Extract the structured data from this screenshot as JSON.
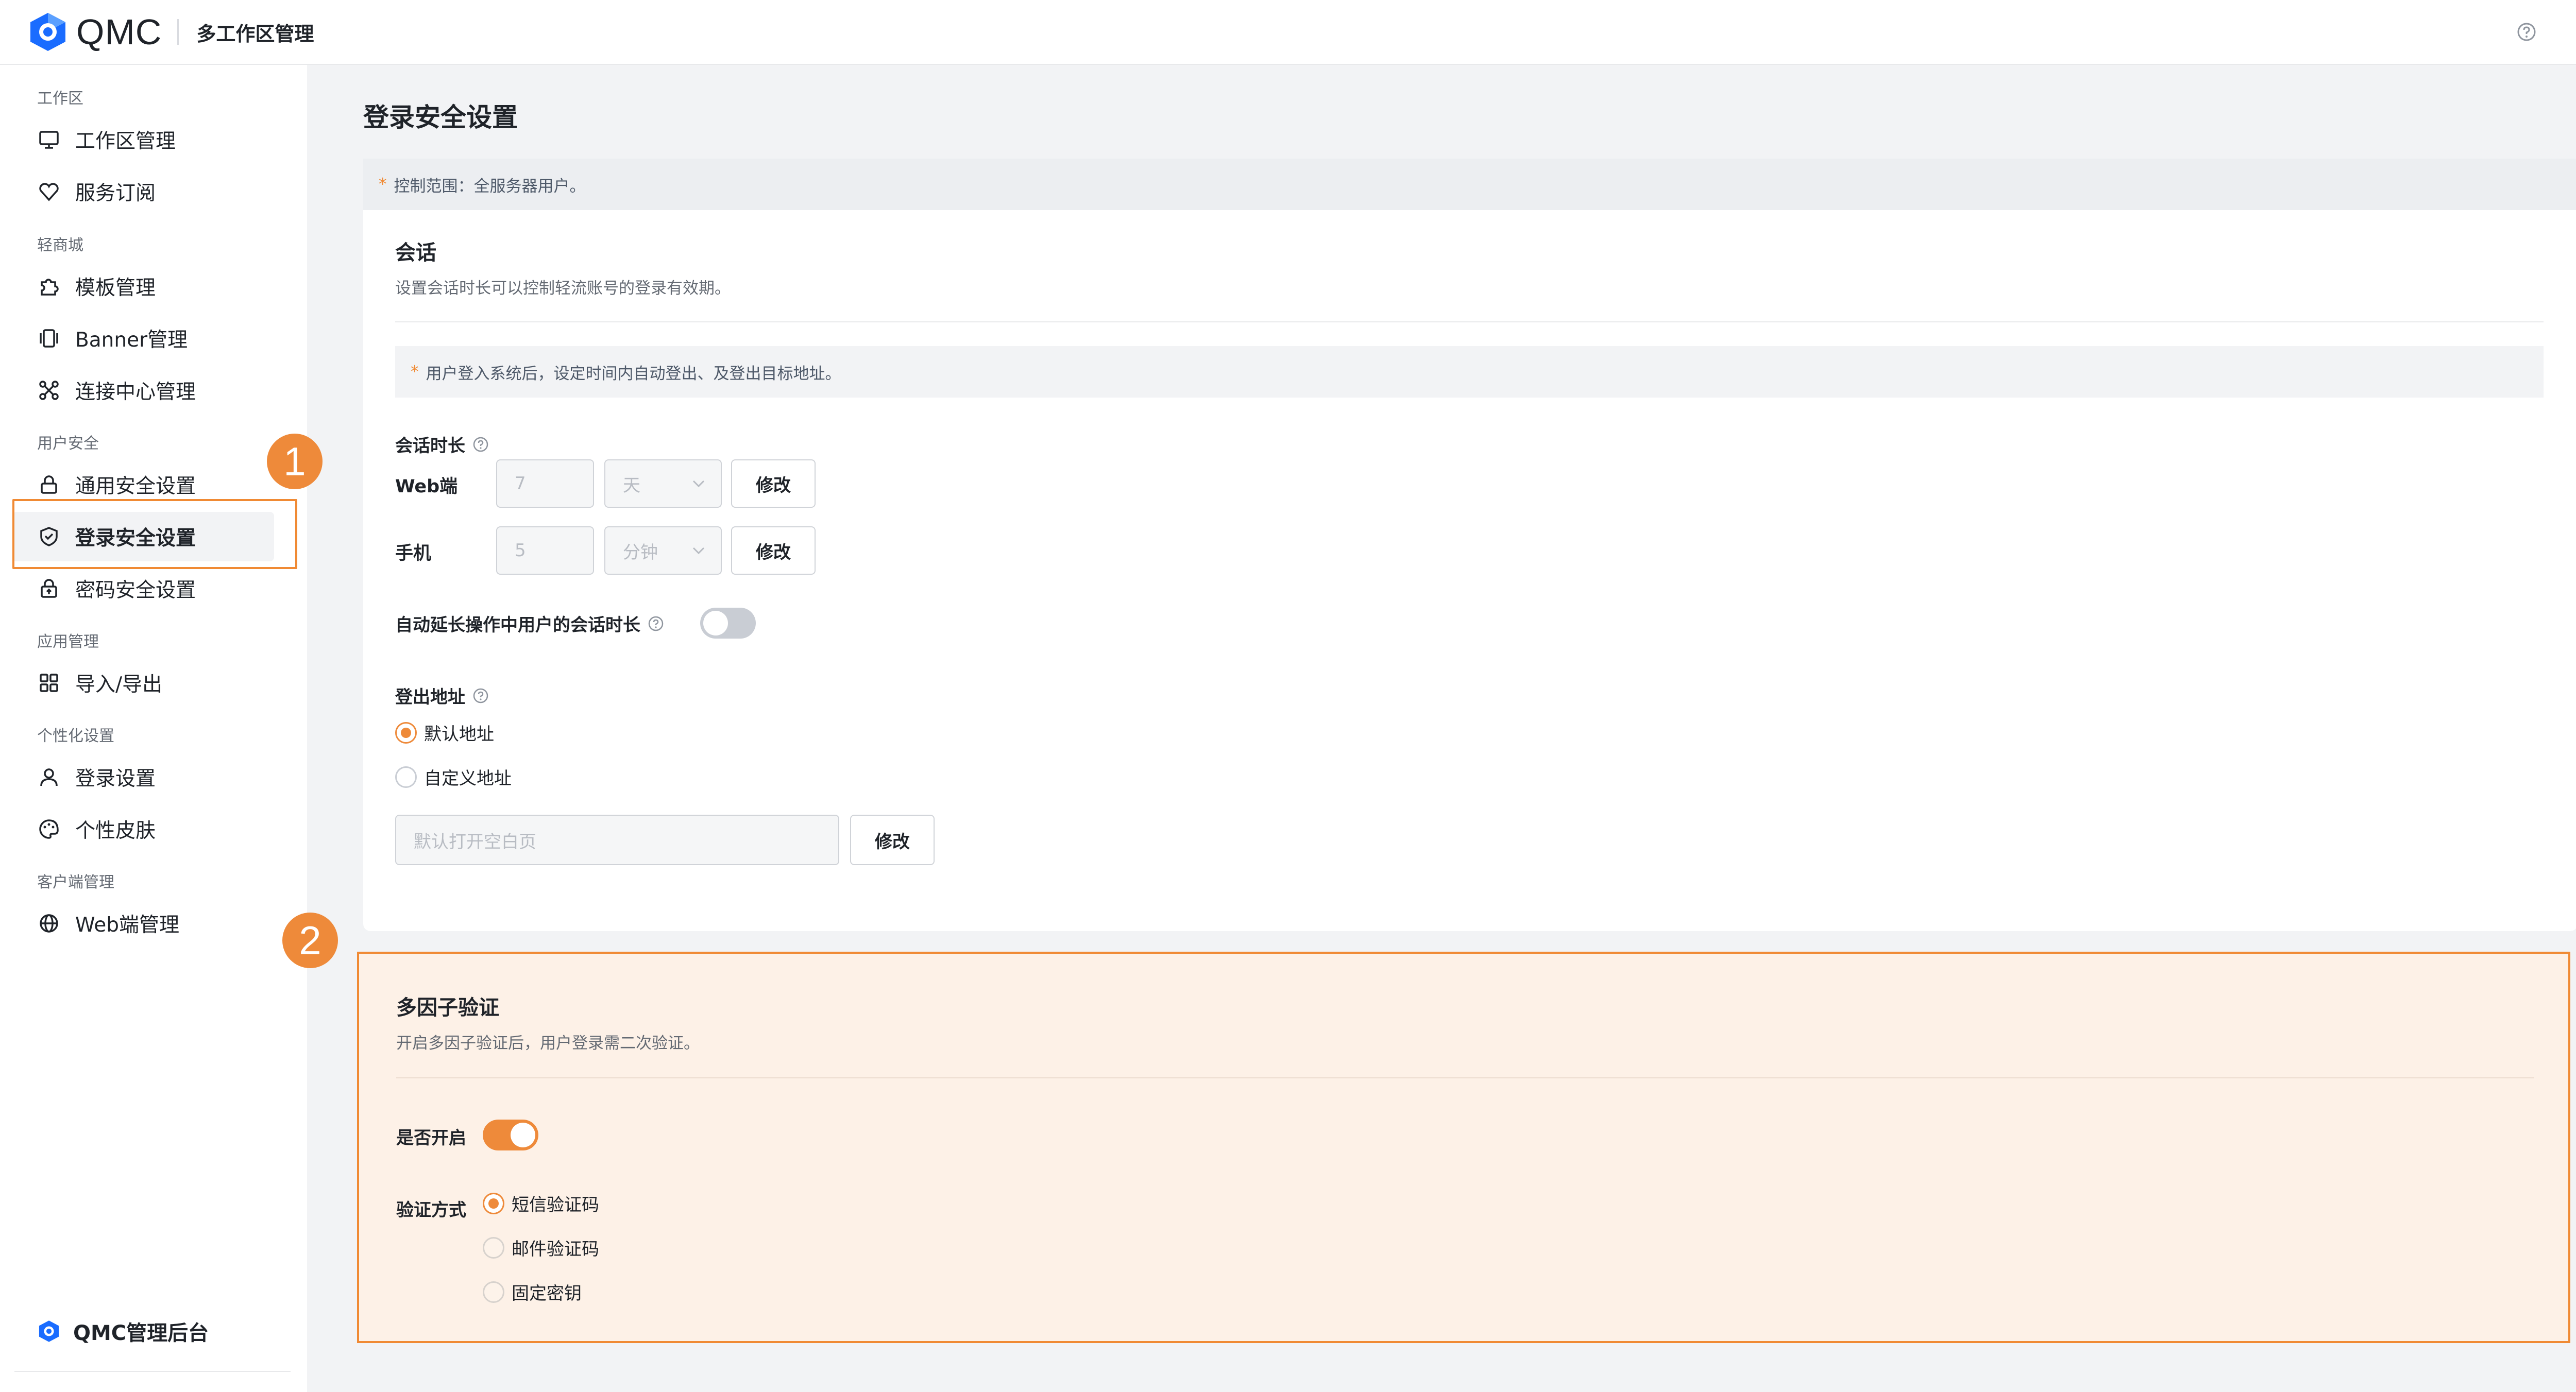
{
  "app": {
    "logo_text": "QMC",
    "title": "多工作区管理",
    "brand_color": "#1a6cff",
    "accent_color": "#ee8a3a"
  },
  "topbar_icons": [
    "help-circle-icon",
    "settings-icon"
  ],
  "sidebar": {
    "sections": [
      {
        "label": "工作区",
        "items": [
          {
            "label": "工作区管理",
            "icon": "monitor-icon"
          },
          {
            "label": "服务订阅",
            "icon": "heart-shield-icon"
          }
        ]
      },
      {
        "label": "轻商城",
        "items": [
          {
            "label": "模板管理",
            "icon": "puzzle-icon"
          },
          {
            "label": "Banner管理",
            "icon": "banner-icon"
          },
          {
            "label": "连接中心管理",
            "icon": "connection-icon"
          }
        ]
      },
      {
        "label": "用户安全",
        "items": [
          {
            "label": "通用安全设置",
            "icon": "lock-icon"
          },
          {
            "label": "登录安全设置",
            "icon": "shield-check-icon",
            "active": true
          },
          {
            "label": "密码安全设置",
            "icon": "lock-upload-icon"
          }
        ]
      },
      {
        "label": "应用管理",
        "items": [
          {
            "label": "导入/导出",
            "icon": "grid-icon"
          }
        ]
      },
      {
        "label": "个性化设置",
        "items": [
          {
            "label": "登录设置",
            "icon": "user-icon"
          },
          {
            "label": "个性皮肤",
            "icon": "palette-icon"
          }
        ]
      },
      {
        "label": "客户端管理",
        "items": [
          {
            "label": "Web端管理",
            "icon": "globe-icon"
          }
        ]
      }
    ],
    "admin_link": "QMC管理后台"
  },
  "badges": [
    "1",
    "2"
  ],
  "main": {
    "page_title": "登录安全设置",
    "scope_note": "控制范围：全服务器用户。",
    "session": {
      "title": "会话",
      "desc": "设置会话时长可以控制轻流账号的登录有效期。",
      "note": "用户登入系统后，设定时间内自动登出、及登出目标地址。",
      "duration_label": "会话时长",
      "web": {
        "label": "Web端",
        "value": "7",
        "unit": "天",
        "button": "修改"
      },
      "mobile": {
        "label": "手机",
        "value": "5",
        "unit": "分钟",
        "button": "修改"
      },
      "auto_extend_label": "自动延长操作中用户的会话时长",
      "auto_extend_on": false,
      "logout_label": "登出地址",
      "logout_options": [
        {
          "label": "默认地址",
          "checked": true
        },
        {
          "label": "自定义地址",
          "checked": false
        }
      ],
      "logout_placeholder": "默认打开空白页",
      "logout_button": "修改"
    },
    "mfa": {
      "title": "多因子验证",
      "desc": "开启多因子验证后，用户登录需二次验证。",
      "enable_label": "是否开启",
      "enabled": true,
      "method_label": "验证方式",
      "methods": [
        {
          "label": "短信验证码",
          "checked": true
        },
        {
          "label": "邮件验证码",
          "checked": false
        },
        {
          "label": "固定密钥",
          "checked": false
        }
      ]
    }
  }
}
